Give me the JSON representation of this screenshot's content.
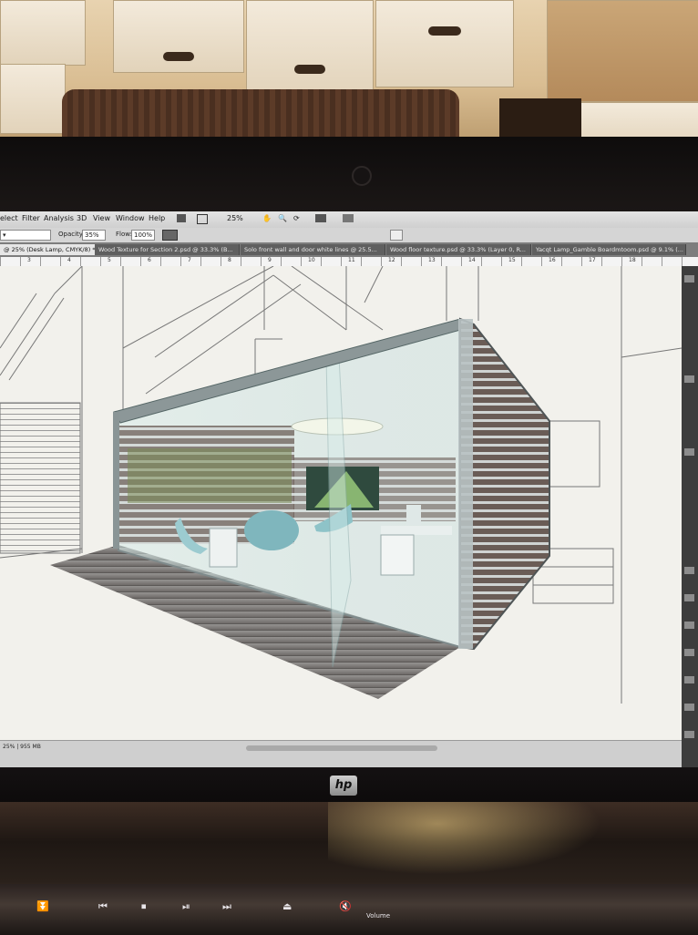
{
  "photoshop": {
    "menus": [
      "elect",
      "Filter",
      "Analysis",
      "3D",
      "View",
      "Window",
      "Help"
    ],
    "zoom_select": "25%",
    "options": {
      "opacity_label": "Opacity:",
      "opacity_value": "35%",
      "flow_label": "Flow:",
      "flow_value": "100%"
    },
    "tabs": [
      "@ 25% (Desk Lamp, CMYK/8) *",
      "Wood Texture for Section 2.psd @ 33.3% (B...",
      "Solo front wall and door white lines @ 25.5...",
      "Wood floor texture.psd @ 33.3% (Layer 0, R...",
      "Yacqt Lamp_Gamble Boardmtoom.psd @ 9.1% (..."
    ],
    "ruler_numbers": [
      "3",
      "4",
      "5",
      "6",
      "7",
      "8",
      "9",
      "10",
      "11",
      "12",
      "13",
      "14",
      "15",
      "16",
      "17",
      "18"
    ],
    "status_zoom": "25% | 955 MB"
  },
  "laptop": {
    "brand": "hp",
    "media_keys": [
      "⏬",
      "⏮",
      "⏹",
      "⏯",
      "⏭",
      "⏏",
      "🔇",
      "Volume"
    ]
  },
  "colors": {
    "bezel": "#141112",
    "canvas": "#f2f1ec",
    "slat_wood": "#6b5d57",
    "glass_tint": "#9fc7c9"
  }
}
